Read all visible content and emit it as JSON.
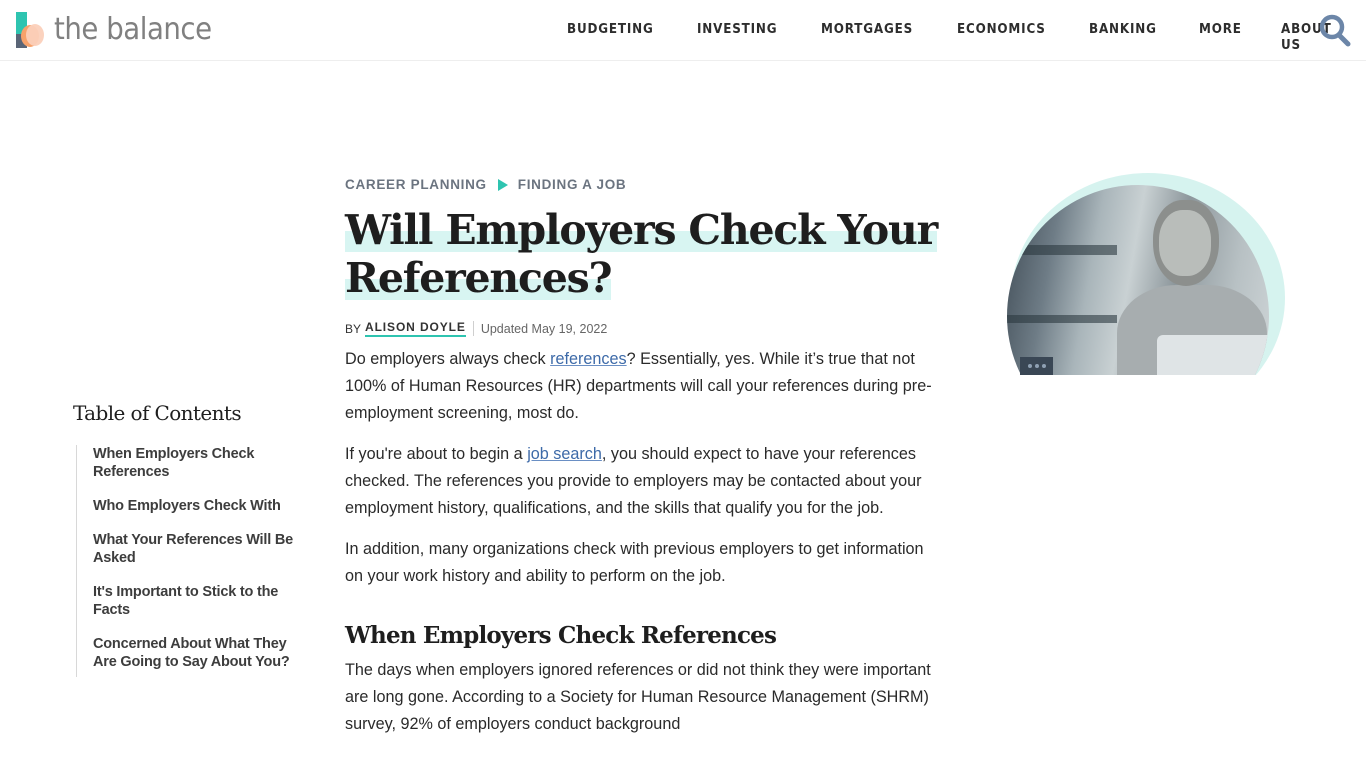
{
  "header": {
    "logo_text": "the balance",
    "nav": [
      {
        "label": "BUDGETING"
      },
      {
        "label": "INVESTING"
      },
      {
        "label": "MORTGAGES"
      },
      {
        "label": "ECONOMICS"
      },
      {
        "label": "BANKING"
      },
      {
        "label": "MORE"
      },
      {
        "label": "ABOUT US"
      }
    ],
    "search_icon": "search-icon"
  },
  "colors": {
    "accent": "#2ec4b0",
    "link": "#3d6aa8",
    "title_highlight": "#d8f5f2",
    "search_icon": "#6c86a8"
  },
  "breadcrumb": {
    "items": [
      {
        "label": "CAREER PLANNING"
      },
      {
        "label": "FINDING A JOB"
      }
    ]
  },
  "article": {
    "title": "Will Employers Check Your References?",
    "byline": {
      "by": "BY",
      "author": "ALISON DOYLE",
      "updated": "Updated May 19, 2022"
    },
    "paragraphs": {
      "p1_before": "Do employers always check ",
      "p1_link": "references",
      "p1_after": "? Essentially, yes. While it’s true that not 100% of Human Resources (HR) departments will call your references during pre-employment screening, most do.",
      "p2_before": "If you're about to begin a ",
      "p2_link": "job search",
      "p2_after": ", you should expect to have your references checked. The references you provide to employers may be contacted about your employment history, qualifications, and the skills that qualify you for the job.",
      "p3": "In addition, many organizations check with previous employers to get information on your work history and ability to perform on the job.",
      "h2": "When Employers Check References",
      "p4": "The days when employers ignored references or did not think they were important are long gone. According to a Society for Human Resource Management (SHRM) survey, 92% of employers conduct background"
    }
  },
  "toc": {
    "title": "Table of Contents",
    "items": [
      {
        "label": "When Employers Check References"
      },
      {
        "label": "Who Employers Check With"
      },
      {
        "label": "What Your References Will Be Asked"
      },
      {
        "label": "It's Important to Stick to the Facts"
      },
      {
        "label": "Concerned About What They Are Going to Say About You?"
      }
    ]
  },
  "hero": {
    "description": "woman smiling on phone at laptop",
    "more_icon": "ellipsis-icon"
  }
}
